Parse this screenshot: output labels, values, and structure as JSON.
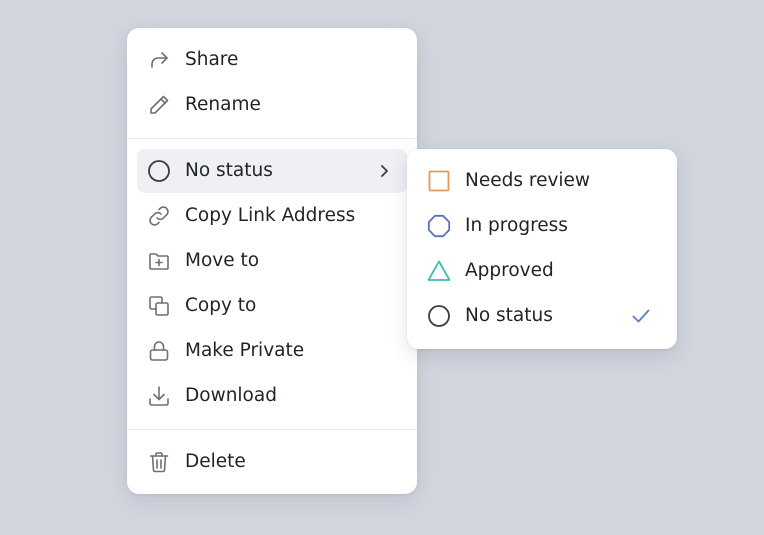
{
  "menu": {
    "items": [
      {
        "label": "Share",
        "icon": "share-icon"
      },
      {
        "label": "Rename",
        "icon": "pencil-icon"
      },
      {
        "label": "No status",
        "icon": "circle-icon",
        "has_submenu": true
      },
      {
        "label": "Copy Link Address",
        "icon": "link-icon"
      },
      {
        "label": "Move to",
        "icon": "folder-plus-icon"
      },
      {
        "label": "Copy to",
        "icon": "copy-icon"
      },
      {
        "label": "Make Private",
        "icon": "lock-icon"
      },
      {
        "label": "Download",
        "icon": "download-icon"
      },
      {
        "label": "Delete",
        "icon": "trash-icon"
      }
    ]
  },
  "status_submenu": {
    "options": [
      {
        "label": "Needs review",
        "icon": "square-icon",
        "color": "#e09a5a"
      },
      {
        "label": "In progress",
        "icon": "octagon-icon",
        "color": "#5b6fbf"
      },
      {
        "label": "Approved",
        "icon": "triangle-icon",
        "color": "#3dbdb6"
      },
      {
        "label": "No status",
        "icon": "circle-icon",
        "color": "#3a3d42",
        "selected": true
      }
    ],
    "check_color": "#5b7fc4"
  }
}
